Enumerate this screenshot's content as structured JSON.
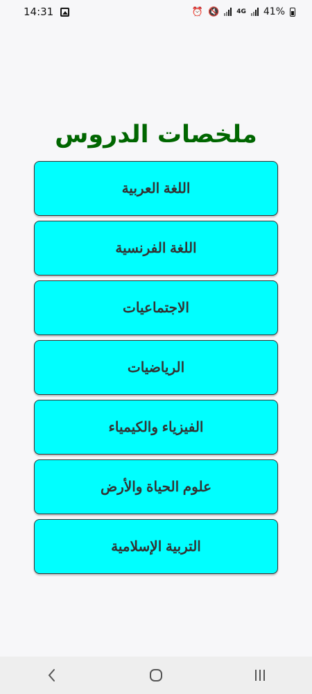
{
  "status_bar": {
    "time": "14:31",
    "network": "4G",
    "battery": "41%"
  },
  "title": "ملخصات الدروس",
  "subjects": [
    "اللغة العربية",
    "اللغة الفرنسية",
    "الاجتماعيات",
    "الرياضيات",
    "الفيزياء والكيمياء",
    "علوم الحياة والأرض",
    "التربية الإسلامية"
  ],
  "colors": {
    "title": "#006600",
    "button_background": "#00ffff",
    "button_text": "#333333"
  },
  "nav_icons": [
    "back-icon",
    "home-icon",
    "recent-apps-icon"
  ]
}
